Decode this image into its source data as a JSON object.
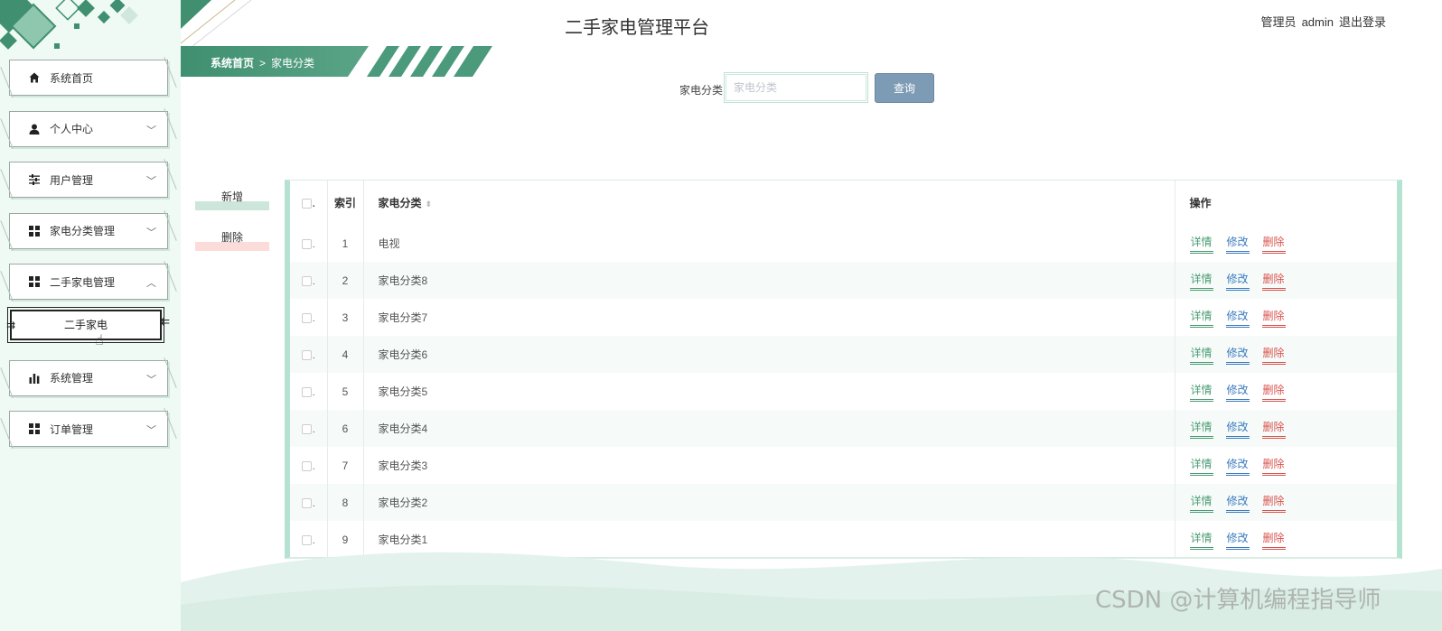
{
  "app": {
    "title": "二手家电管理平台",
    "user_role": "管理员",
    "username": "admin",
    "logout_label": "退出登录"
  },
  "colors": {
    "accent_green": "#3f8f70",
    "sidebar_bg": "#effaf5",
    "search_button": "#7e9bb5",
    "detail_link": "#4a9b73",
    "edit_link": "#3b7bbf",
    "delete_link": "#d9534f"
  },
  "breadcrumb": {
    "home": "系统首页",
    "separator": ">",
    "current": "家电分类"
  },
  "sidebar": {
    "items": [
      {
        "label": "系统首页",
        "icon": "home-icon",
        "chevron": ""
      },
      {
        "label": "个人中心",
        "icon": "person-icon",
        "chevron": "﹀"
      },
      {
        "label": "用户管理",
        "icon": "sliders-icon",
        "chevron": "﹀"
      },
      {
        "label": "家电分类管理",
        "icon": "grid-icon",
        "chevron": "﹀"
      },
      {
        "label": "二手家电管理",
        "icon": "grid-icon",
        "chevron": "︿"
      },
      {
        "label": "系统管理",
        "icon": "bar-chart-icon",
        "chevron": "﹀"
      },
      {
        "label": "订单管理",
        "icon": "grid-icon",
        "chevron": "﹀"
      }
    ],
    "submenu": {
      "label": "二手家电"
    }
  },
  "search": {
    "label": "家电分类",
    "placeholder": "家电分类",
    "value": "",
    "button_label": "查询"
  },
  "actions": {
    "add_label": "新增",
    "delete_label": "删除"
  },
  "table": {
    "headers": {
      "index": "索引",
      "name": "家电分类",
      "ops": "操作"
    },
    "op_labels": {
      "detail": "详情",
      "edit": "修改",
      "delete": "删除"
    },
    "rows": [
      {
        "index": "1",
        "name": "电视"
      },
      {
        "index": "2",
        "name": "家电分类8"
      },
      {
        "index": "3",
        "name": "家电分类7"
      },
      {
        "index": "4",
        "name": "家电分类6"
      },
      {
        "index": "5",
        "name": "家电分类5"
      },
      {
        "index": "6",
        "name": "家电分类4"
      },
      {
        "index": "7",
        "name": "家电分类3"
      },
      {
        "index": "8",
        "name": "家电分类2"
      },
      {
        "index": "9",
        "name": "家电分类1"
      }
    ]
  },
  "watermark": "CSDN @计算机编程指导师"
}
